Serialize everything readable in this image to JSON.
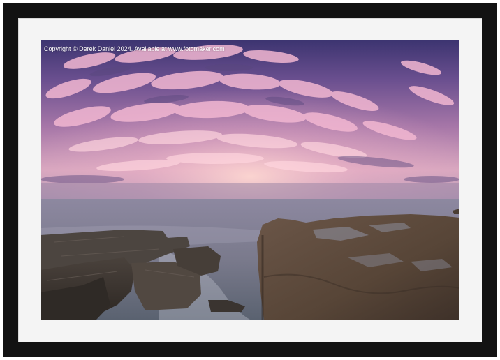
{
  "artwork": {
    "copyright_text": "Copyright © Derek Daniel 2024. Available at www.fotomaker.com"
  },
  "colors": {
    "frame": "#121212",
    "mount": "#f4f4f4",
    "sky_top": "#4a3f7a",
    "cloud_pink": "#e9a8c6",
    "horizon_glow": "#f2c7cf",
    "sea": "#7c7a8e",
    "rock": "#5e4e42"
  }
}
